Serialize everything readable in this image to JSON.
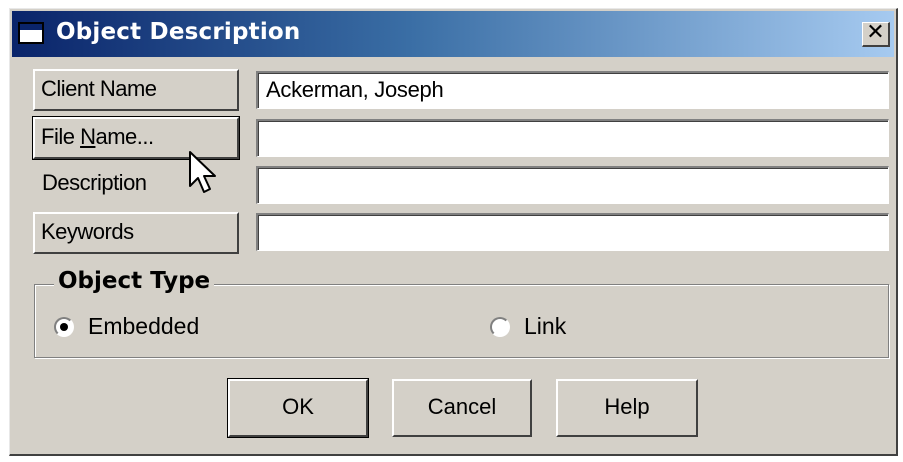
{
  "window": {
    "title": "Object Description",
    "close_label": "✕"
  },
  "fields": {
    "client_name": {
      "button_label": "Client Name",
      "value": "Ackerman, Joseph"
    },
    "file_name": {
      "button_label_pre": "File ",
      "button_label_accel": "N",
      "button_label_post": "ame...",
      "value": ""
    },
    "description": {
      "label": "Description",
      "value": ""
    },
    "keywords": {
      "button_label": "Keywords",
      "value": ""
    }
  },
  "object_type": {
    "legend": "Object Type",
    "options": [
      {
        "label": "Embedded",
        "selected": true
      },
      {
        "label": "Link",
        "selected": false
      }
    ]
  },
  "buttons": {
    "ok": "OK",
    "cancel": "Cancel",
    "help": "Help"
  },
  "colors": {
    "dialog_face": "#d4d0c8",
    "title_start": "#0a246a",
    "title_end": "#a6caf0"
  },
  "icons": {
    "title": "window-icon",
    "cursor": "arrow-cursor-icon"
  }
}
